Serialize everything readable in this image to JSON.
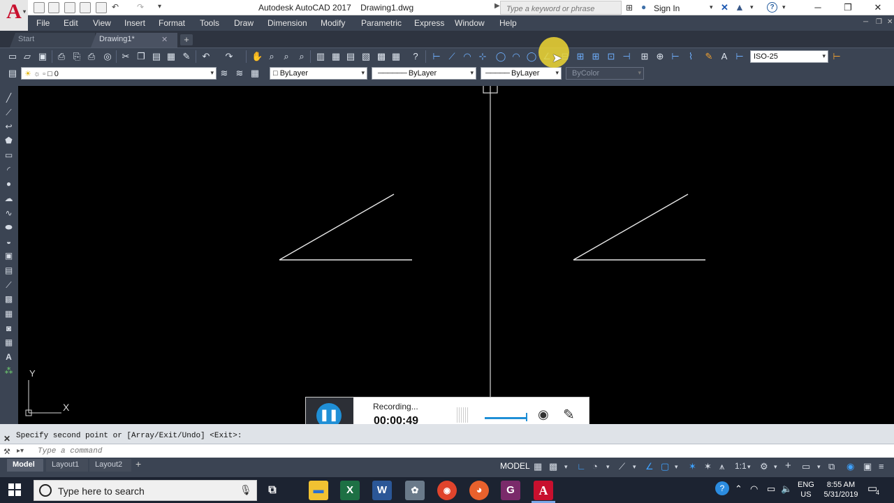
{
  "app": {
    "title": "Autodesk AutoCAD 2017    Drawing1.dwg",
    "logo_letter": "A"
  },
  "search": {
    "placeholder": "Type a keyword or phrase"
  },
  "user": {
    "signin_label": "Sign In"
  },
  "menu": {
    "items": [
      "File",
      "Edit",
      "View",
      "Insert",
      "Format",
      "Tools",
      "Draw",
      "Dimension",
      "Modify",
      "Parametric",
      "Express",
      "Window",
      "Help"
    ]
  },
  "tabs": {
    "start": "Start",
    "drawing": "Drawing1*"
  },
  "toolbar": {
    "dimstyle_value": "ISO-25",
    "layer_value": "0",
    "color_value": "ByLayer",
    "linetype_value": "ByLayer",
    "lineweight_value": "ByLayer",
    "plotstyle_value": "ByColor"
  },
  "ucs": {
    "y_label": "Y",
    "x_label": "X"
  },
  "recorder": {
    "status": "Recording...",
    "elapsed": "00:00:49"
  },
  "command": {
    "history": "Specify second point or [Array/Exit/Undo] <Exit>:",
    "placeholder": "Type a command"
  },
  "layout_tabs": [
    "Model",
    "Layout1",
    "Layout2"
  ],
  "status": {
    "model_label": "MODEL",
    "scale": "1:1"
  },
  "taskbar": {
    "search_placeholder": "Type here to search",
    "lang_top": "ENG",
    "lang_bottom": "US",
    "time": "8:55 AM",
    "date": "5/31/2019",
    "notif_count": "4"
  },
  "colors": {
    "accent": "#1f8fd6",
    "autocad_red": "#c8102e",
    "ui_dark": "#3b4453"
  }
}
